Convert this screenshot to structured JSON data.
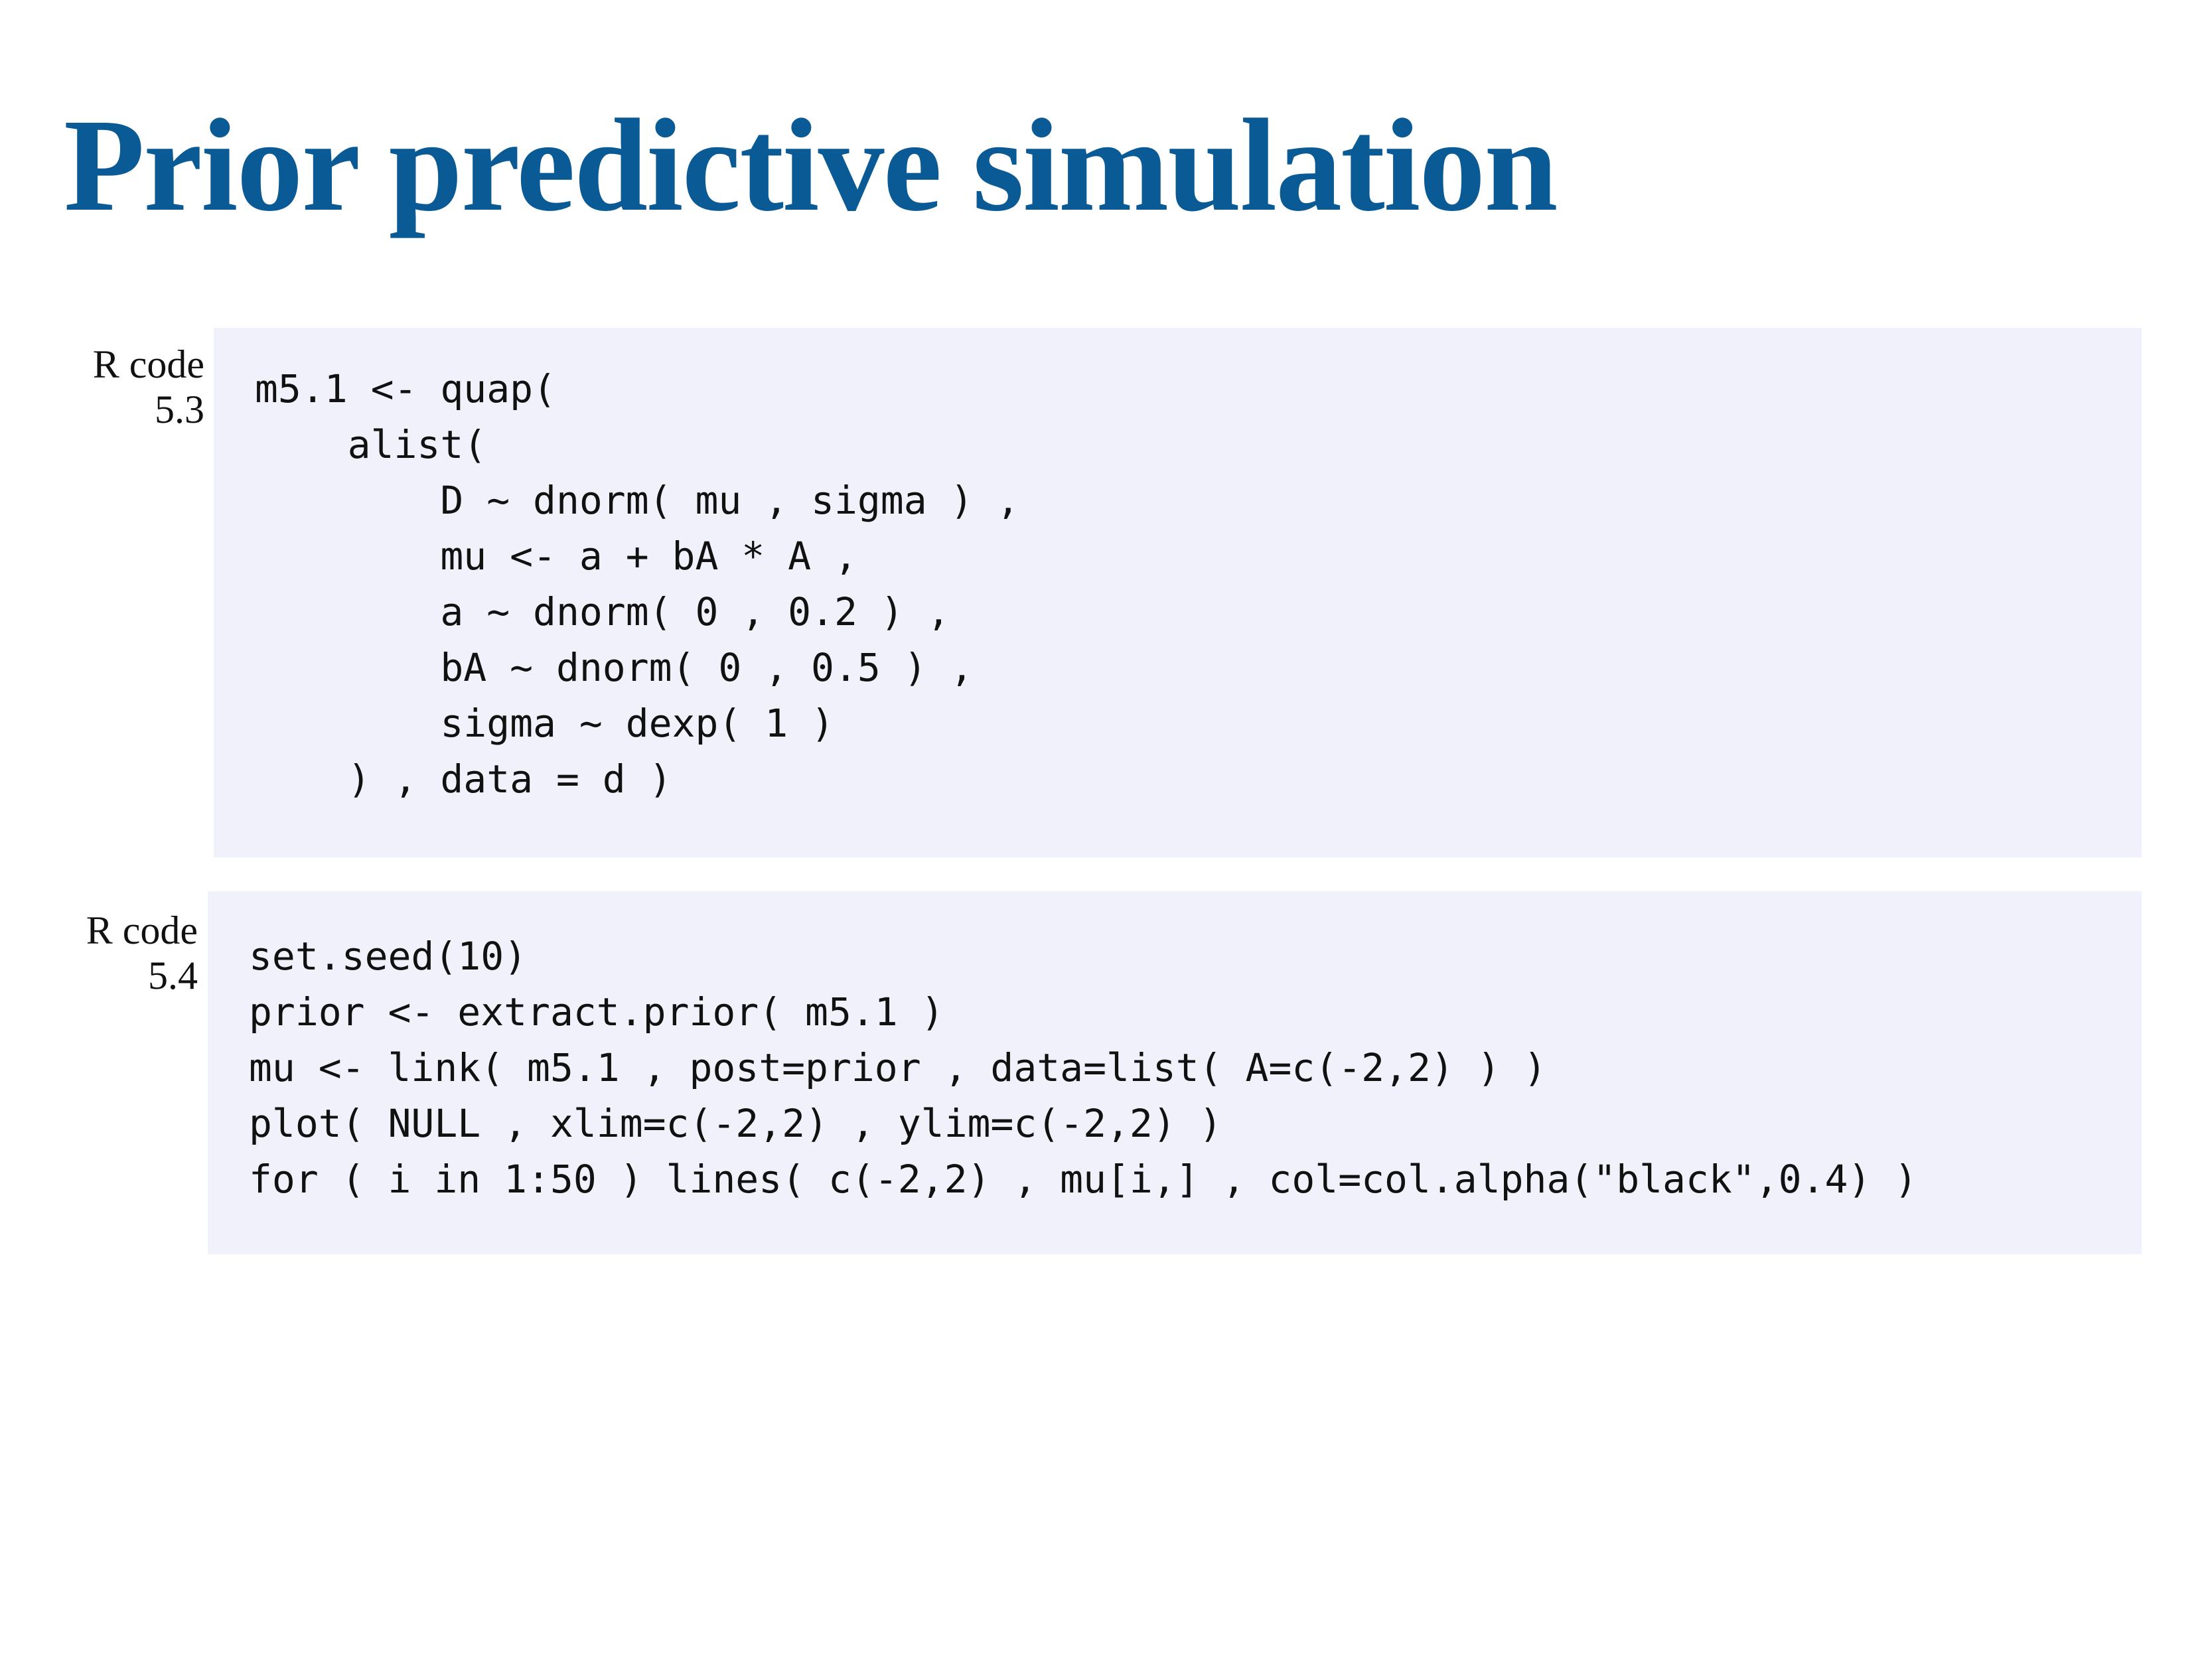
{
  "slide": {
    "title": "Prior predictive simulation"
  },
  "code_blocks": [
    {
      "label_line1": "R code",
      "label_line2": "5.3",
      "lines": [
        "m5.1 <- quap(",
        "    alist(",
        "        D ~ dnorm( mu , sigma ) ,",
        "        mu <- a + bA * A ,",
        "        a ~ dnorm( 0 , 0.2 ) ,",
        "        bA ~ dnorm( 0 , 0.5 ) ,",
        "        sigma ~ dexp( 1 )",
        "    ) , data = d )"
      ]
    },
    {
      "label_line1": "R code",
      "label_line2": "5.4",
      "lines": [
        "set.seed(10)",
        "prior <- extract.prior( m5.1 )",
        "mu <- link( m5.1 , post=prior , data=list( A=c(-2,2) ) )",
        "plot( NULL , xlim=c(-2,2) , ylim=c(-2,2) )",
        "for ( i in 1:50 ) lines( c(-2,2) , mu[i,] , col=col.alpha(\"black\",0.4) )"
      ]
    }
  ],
  "colors": {
    "title": "#0a5a96",
    "code_background": "#f0f1fa",
    "text": "#111111"
  }
}
